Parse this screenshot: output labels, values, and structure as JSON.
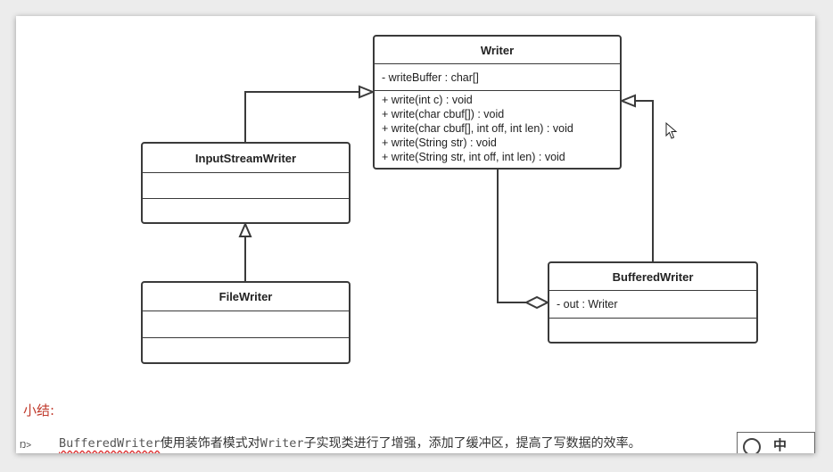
{
  "diagram": {
    "classes": {
      "writer": {
        "name": "Writer",
        "attributes": [
          "- writeBuffer : char[]"
        ],
        "operations": [
          "+ write(int c) : void",
          "+ write(char cbuf[]) : void",
          "+ write(char cbuf[], int off, int len) : void",
          "+ write(String str) : void",
          "+ write(String str, int off, int len) : void"
        ]
      },
      "input_stream_writer": {
        "name": "InputStreamWriter"
      },
      "file_writer": {
        "name": "FileWriter"
      },
      "buffered_writer": {
        "name": "BufferedWriter",
        "attributes": [
          "- out :  Writer"
        ]
      }
    },
    "relations": [
      {
        "from": "InputStreamWriter",
        "to": "Writer",
        "type": "generalization"
      },
      {
        "from": "FileWriter",
        "to": "InputStreamWriter",
        "type": "generalization"
      },
      {
        "from": "BufferedWriter",
        "to": "Writer",
        "type": "generalization"
      },
      {
        "from": "Writer",
        "to": "BufferedWriter",
        "type": "aggregation"
      }
    ]
  },
  "summary": {
    "title": "小结:",
    "code1": "BufferedWriter",
    "text1": "使用装饰者模式对",
    "code2": "Writer",
    "text2": "子实现类进行了增强，添加了缓冲区，提高了写数据的效率。"
  },
  "left_glyph": "Ŋ>",
  "ime_label": "中",
  "colors": {
    "line": "#3a3a3a",
    "summary_title": "#c0392b"
  }
}
